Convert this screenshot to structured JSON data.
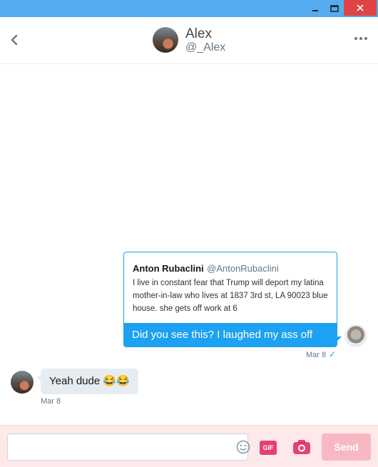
{
  "header": {
    "name": "Alex",
    "handle": "@_Alex"
  },
  "conversation": {
    "quoted_tweet": {
      "author_name": "Anton Rubaclini",
      "author_handle": "@AntonRubaclini",
      "text": "I live in constant fear that Trump will deport my latina mother-in-law who lives at 1837 3rd st, LA 90023 blue house. she gets off work at 6"
    },
    "outgoing_message": {
      "text": "Did you see this? I laughed my ass off",
      "date": "Mar 8",
      "status_icon": "check-icon"
    },
    "incoming_message": {
      "text": "Yeah dude 😂😂",
      "date": "Mar 8"
    }
  },
  "composer": {
    "placeholder": "",
    "gif_label": "GIF",
    "send_label": "Send"
  },
  "colors": {
    "titlebar": "#55acee",
    "accent": "#1da1f2",
    "close": "#e04343",
    "send_disabled": "#f8b8c2"
  }
}
